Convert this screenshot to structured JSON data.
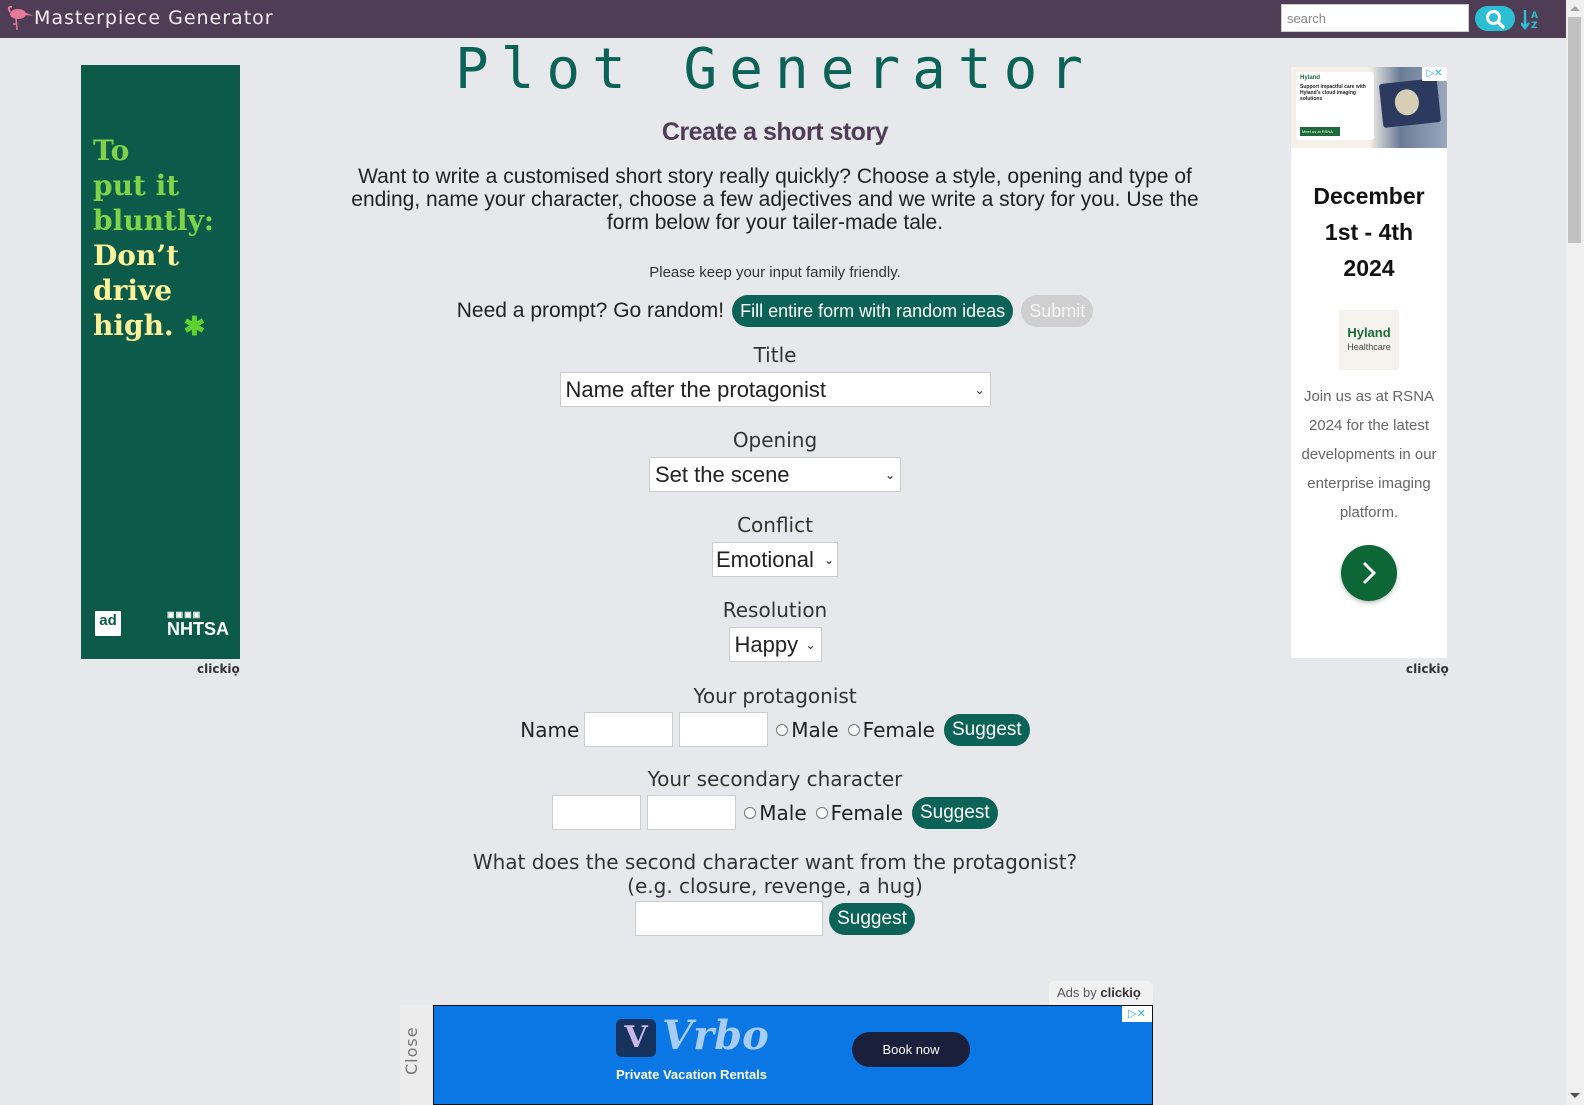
{
  "nav": {
    "brand": "Masterpiece Generator",
    "search_placeholder": "search",
    "colors": {
      "bar": "#4f3d56",
      "accent": "#2cbfd3"
    }
  },
  "main": {
    "title": "Plot Generator",
    "subtitle": "Create a short story",
    "intro": "Want to write a customised short story really quickly? Choose a style, opening and type of ending, name your character, choose a few adjectives and we write a story for you. Use the form below for your tailer-made tale.",
    "family_note": "Please keep your input family friendly.",
    "random_label": "Need a prompt? Go random!",
    "random_button": "Fill entire form with random ideas",
    "submit_button": "Submit",
    "accent_color": "#0b6257",
    "fields": {
      "title": {
        "label": "Title",
        "value": "Name after the protagonist"
      },
      "opening": {
        "label": "Opening",
        "value": "Set the scene"
      },
      "conflict": {
        "label": "Conflict",
        "value": "Emotional"
      },
      "resolution": {
        "label": "Resolution",
        "value": "Happy"
      }
    },
    "protagonist": {
      "heading": "Your protagonist",
      "name_label": "Name",
      "first_name": "",
      "last_name": "",
      "male": "Male",
      "female": "Female",
      "suggest": "Suggest"
    },
    "secondary": {
      "heading": "Your secondary character",
      "first_name": "",
      "last_name": "",
      "male": "Male",
      "female": "Female",
      "suggest": "Suggest"
    },
    "want": {
      "question": "What does the second character want from the protagonist?",
      "hint": "(e.g. closure, revenge, a hug)",
      "value": "",
      "suggest": "Suggest"
    }
  },
  "ads": {
    "left": {
      "line1": "To",
      "line2": "put it",
      "line3": "bluntly:",
      "line4": "Don’t",
      "line5": "drive",
      "line6": "high.",
      "leaf": "✱",
      "adcouncil": "ad",
      "nhtsa": "NHTSA",
      "clickio": "clickiọ"
    },
    "right": {
      "banner_logo": "Hyland",
      "banner_title": "Support impactful care with Hyland’s cloud imaging solutions",
      "banner_button": "Meet us at RSNA",
      "date_line1": "December",
      "date_line2": "1st - 4th",
      "date_line3": "2024",
      "logo_name": "Hyland",
      "logo_sub": "Healthcare",
      "body": "Join us as at RSNA 2024 for the latest developments in our enterprise imaging platform.",
      "clickio": "clickiọ"
    },
    "bottom": {
      "ads_by": "Ads by",
      "ads_by_brand": "clickiọ",
      "close": "Close",
      "brand": "Vrbo",
      "tagline": "Private Vacation Rentals",
      "cta": "Book now"
    },
    "adchoices": "▷✕"
  }
}
